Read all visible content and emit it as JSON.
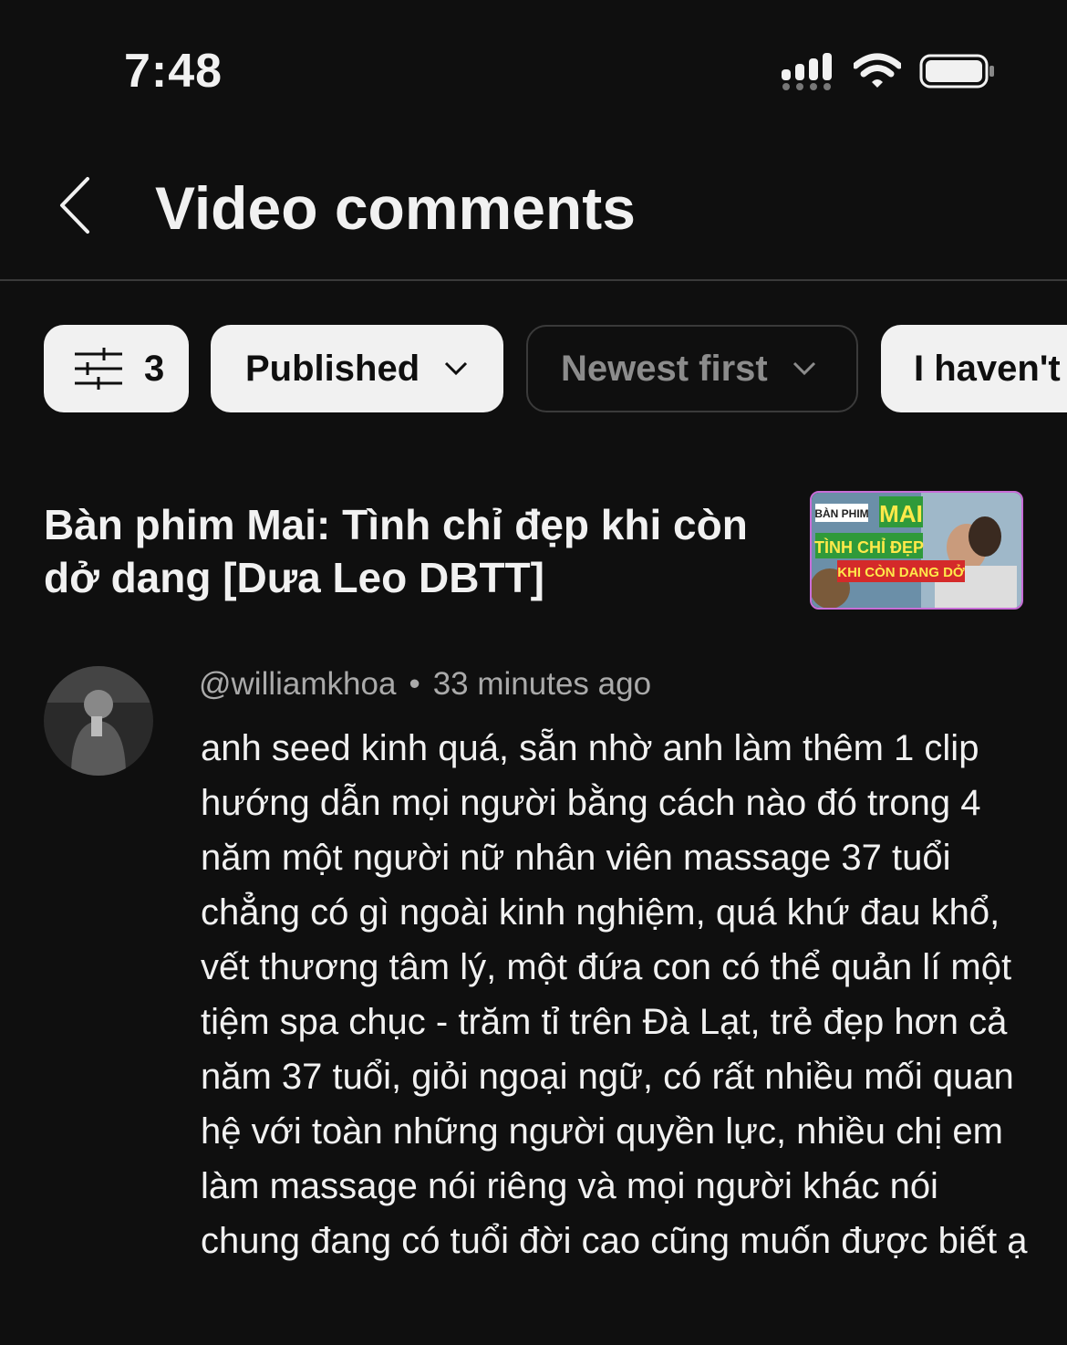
{
  "status_bar": {
    "time": "7:48"
  },
  "header": {
    "title": "Video comments"
  },
  "filters": {
    "filter_count": "3",
    "published": "Published",
    "sort": "Newest first",
    "unreplied": "I haven't"
  },
  "video": {
    "title": "Bàn phim Mai: Tình chỉ đẹp khi còn dở dang [Dưa Leo DBTT]",
    "thumbnail_text": {
      "tag": "BÀN PHIM",
      "name": "MAI",
      "line1": "TÌNH CHỈ ĐẸP",
      "line2": "KHI CÒN DANG DỞ"
    }
  },
  "comment": {
    "author": "@williamkhoa",
    "time": "33 minutes ago",
    "text": "anh seed kinh quá, sẵn nhờ anh làm thêm 1 clip hướng dẫn mọi người bằng cách nào đó trong 4 năm một người nữ nhân viên massage 37 tuổi chẳng có gì ngoài kinh nghiệm, quá khứ đau khổ, vết thương tâm lý, một đứa con có thể quản lí một tiệm spa chục - trăm tỉ trên Đà Lạt, trẻ đẹp hơn cả năm 37 tuổi, giỏi ngoại ngữ, có rất nhiều mối quan hệ với toàn những người quyền lực, nhiều chị em làm massage nói riêng và mọi người khác nói chung đang có tuổi đời cao cũng muốn được biết ạ"
  },
  "colors": {
    "background": "#0f0f0f",
    "chip_light": "#f1f1f1",
    "meta_text": "#aaaaaa",
    "thumb_border": "#c86dd7"
  }
}
